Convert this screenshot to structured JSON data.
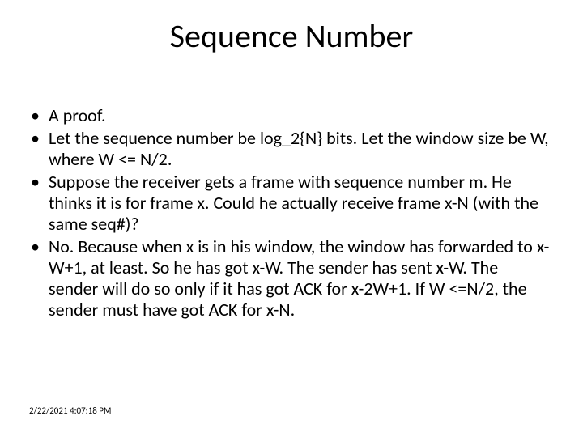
{
  "title": "Sequence Number",
  "bullets": [
    "A proof.",
    "Let the sequence number be log_2{N} bits. Let the window size be W, where W <= N/2.",
    "Suppose the receiver gets a frame with sequence number m. He thinks it is for frame x. Could he actually receive frame x-N (with the same seq#)?",
    "No. Because when x is in his window, the window has forwarded to x-W+1, at least. So he has got x-W. The sender has sent x-W. The sender will do so only if it has got ACK for x-2W+1. If W <=N/2, the sender must have got ACK for x-N."
  ],
  "footer": "2/22/2021 4:07:18 PM"
}
